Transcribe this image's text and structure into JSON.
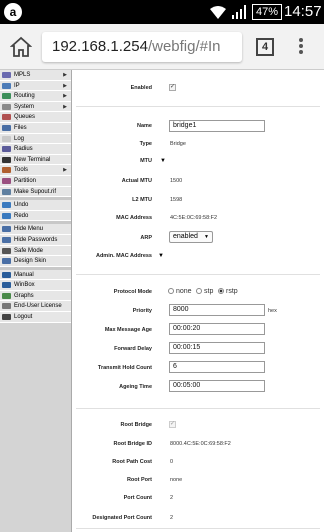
{
  "status_bar": {
    "time": "14:57",
    "battery": "47%"
  },
  "browser": {
    "url_host": "192.168.1.254",
    "url_path": "/webfig/#In",
    "tab_count": "4"
  },
  "sidebar": {
    "items": [
      {
        "label": "MPLS",
        "icon_color": "#6a6ab0",
        "has_submenu": true
      },
      {
        "label": "IP",
        "icon_color": "#4d7cb8",
        "has_submenu": true
      },
      {
        "label": "Routing",
        "icon_color": "#3d8f5a",
        "has_submenu": true
      },
      {
        "label": "System",
        "icon_color": "#8a8a8a",
        "has_submenu": true
      },
      {
        "label": "Queues",
        "icon_color": "#b05050",
        "has_submenu": false
      },
      {
        "label": "Files",
        "icon_color": "#4a6fa5",
        "has_submenu": false
      },
      {
        "label": "Log",
        "icon_color": "#c9c9c9",
        "has_submenu": false
      },
      {
        "label": "Radius",
        "icon_color": "#5b5b9a",
        "has_submenu": false
      },
      {
        "label": "New Terminal",
        "icon_color": "#333333",
        "has_submenu": false
      },
      {
        "label": "Tools",
        "icon_color": "#b06030",
        "has_submenu": true
      },
      {
        "label": "Partition",
        "icon_color": "#9a5080",
        "has_submenu": false
      },
      {
        "label": "Make Supout.rif",
        "icon_color": "#6080a0",
        "has_submenu": false
      },
      {
        "label": "Undo",
        "icon_color": "#3a7abf",
        "has_submenu": false
      },
      {
        "label": "Redo",
        "icon_color": "#3a7abf",
        "has_submenu": false
      },
      {
        "label": "Hide Menu",
        "icon_color": "#4a6fa5",
        "has_submenu": false
      },
      {
        "label": "Hide Passwords",
        "icon_color": "#4a6fa5",
        "has_submenu": false
      },
      {
        "label": "Safe Mode",
        "icon_color": "#555555",
        "has_submenu": false
      },
      {
        "label": "Design Skin",
        "icon_color": "#4a6fa5",
        "has_submenu": false
      },
      {
        "label": "Manual",
        "icon_color": "#2a5d9a",
        "has_submenu": false
      },
      {
        "label": "WinBox",
        "icon_color": "#2a5d9a",
        "has_submenu": false
      },
      {
        "label": "Graphs",
        "icon_color": "#4a8a4a",
        "has_submenu": false
      },
      {
        "label": "End-User License",
        "icon_color": "#777777",
        "has_submenu": false
      },
      {
        "label": "Logout",
        "icon_color": "#444444",
        "has_submenu": false
      }
    ]
  },
  "form": {
    "enabled": {
      "label": "Enabled",
      "checked": true
    },
    "name": {
      "label": "Name",
      "value": "bridge1"
    },
    "type": {
      "label": "Type",
      "value": "Bridge"
    },
    "mtu": {
      "label": "MTU"
    },
    "actual_mtu": {
      "label": "Actual MTU",
      "value": "1500"
    },
    "l2_mtu": {
      "label": "L2 MTU",
      "value": "1598"
    },
    "mac_address": {
      "label": "MAC Address",
      "value": "4C:5E:0C:69:58:F2"
    },
    "arp": {
      "label": "ARP",
      "value": "enabled"
    },
    "admin_mac": {
      "label": "Admin. MAC Address"
    },
    "protocol_mode": {
      "label": "Protocol Mode",
      "options": [
        "none",
        "stp",
        "rstp"
      ],
      "selected": "rstp"
    },
    "priority": {
      "label": "Priority",
      "value": "8000",
      "unit": "hex"
    },
    "max_message_age": {
      "label": "Max Message Age",
      "value": "00:00:20"
    },
    "forward_delay": {
      "label": "Forward Delay",
      "value": "00:00:15"
    },
    "transmit_hold_count": {
      "label": "Transmit Hold Count",
      "value": "6"
    },
    "ageing_time": {
      "label": "Ageing Time",
      "value": "00:05:00"
    },
    "root_bridge": {
      "label": "Root Bridge",
      "checked": true
    },
    "root_bridge_id": {
      "label": "Root Bridge ID",
      "value": "8000.4C:5E:0C:69:58:F2"
    },
    "root_path_cost": {
      "label": "Root Path Cost",
      "value": "0"
    },
    "root_port": {
      "label": "Root Port",
      "value": "none"
    },
    "port_count": {
      "label": "Port Count",
      "value": "2"
    },
    "designated_port_count": {
      "label": "Designated Port Count",
      "value": "2"
    }
  }
}
